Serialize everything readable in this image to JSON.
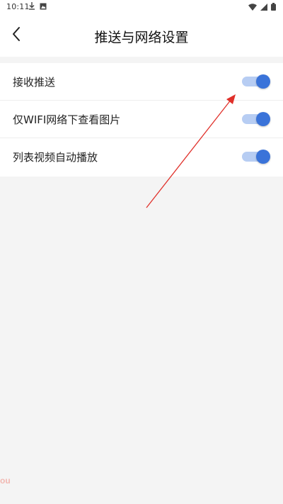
{
  "status_bar": {
    "time": "10:11",
    "icons": [
      "download-icon",
      "gallery-icon",
      "wifi-icon",
      "signal-icon",
      "battery-icon"
    ]
  },
  "app_bar": {
    "title": "推送与网络设置",
    "back_icon": "chevron-left-icon"
  },
  "settings": {
    "items": [
      {
        "label": "接收推送",
        "enabled": true
      },
      {
        "label": "仅WIFI网络下查看图片",
        "enabled": true
      },
      {
        "label": "列表视频自动播放",
        "enabled": true
      }
    ]
  },
  "watermark": {
    "text": "ou"
  },
  "colors": {
    "toggle_track": "#b7cdf3",
    "toggle_thumb": "#3a73d9",
    "annotation_arrow": "#e0302a",
    "background": "#f4f4f4"
  }
}
